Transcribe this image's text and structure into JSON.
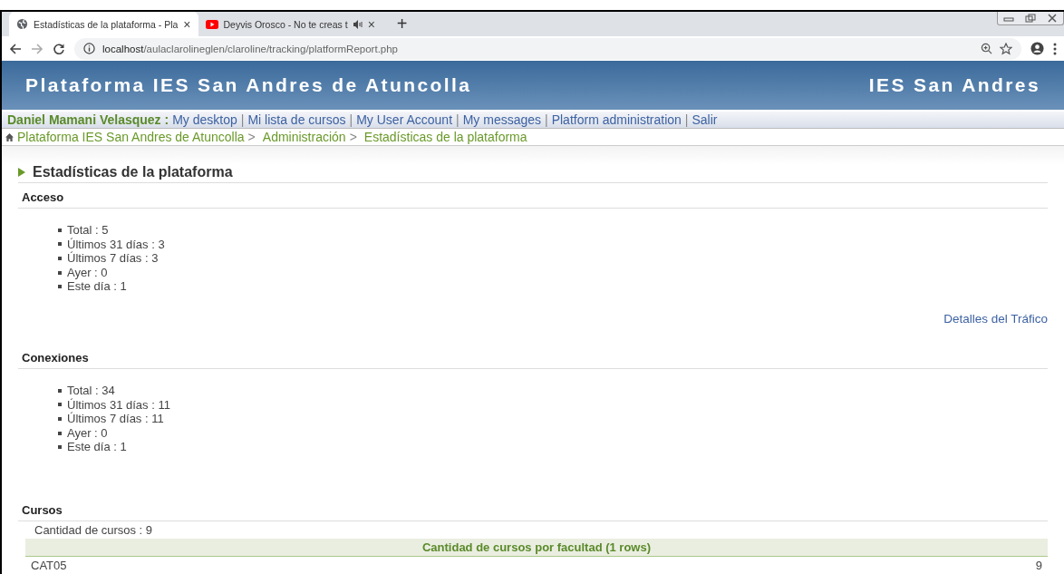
{
  "browser": {
    "tabs": [
      {
        "title": "Estadísticas de la plataforma - Pla",
        "kind": "globe",
        "selected": true,
        "close": "×"
      },
      {
        "title": "Deyvis Orosco - No te creas t",
        "kind": "video",
        "selected": false,
        "close": "×"
      }
    ],
    "new_tab": "+",
    "address": {
      "host": "localhost",
      "path": "/aulaclarolineglen/claroline/tracking/platformReport.php"
    }
  },
  "banner": {
    "title": "Plataforma IES San Andres de Atuncolla",
    "right": "IES San Andres"
  },
  "user_bar": {
    "user": "Daniel Mamani Velasquez :",
    "separator": "|",
    "links": [
      "My desktop",
      "Mi lista de cursos",
      "My User Account",
      "My messages",
      "Platform administration",
      "Salir"
    ]
  },
  "breadcrumb": {
    "separator": ">",
    "items": [
      "Plataforma IES San Andres de Atuncolla",
      "Administración",
      "Estadísticas de la plataforma"
    ]
  },
  "page_title": "Estadísticas de la plataforma",
  "sections": [
    {
      "kind": "stats",
      "title": "Acceso",
      "items": [
        "Total : 5",
        "Últimos 31 días : 3",
        "Últimos 7 días : 3",
        "Ayer : 0",
        "Este día : 1"
      ],
      "link": "Detalles del Tráfico"
    },
    {
      "kind": "stats",
      "title": "Conexiones",
      "items": [
        "Total : 34",
        "Últimos 31 días : 11",
        "Últimos 7 días : 11",
        "Ayer : 0",
        "Este día : 1"
      ]
    },
    {
      "kind": "table",
      "title": "Cursos",
      "summary": "Cantidad de cursos : 9",
      "table_title": "Cantidad de cursos por facultad (1 rows)",
      "rows": [
        [
          "CAT05",
          "9"
        ]
      ]
    }
  ]
}
